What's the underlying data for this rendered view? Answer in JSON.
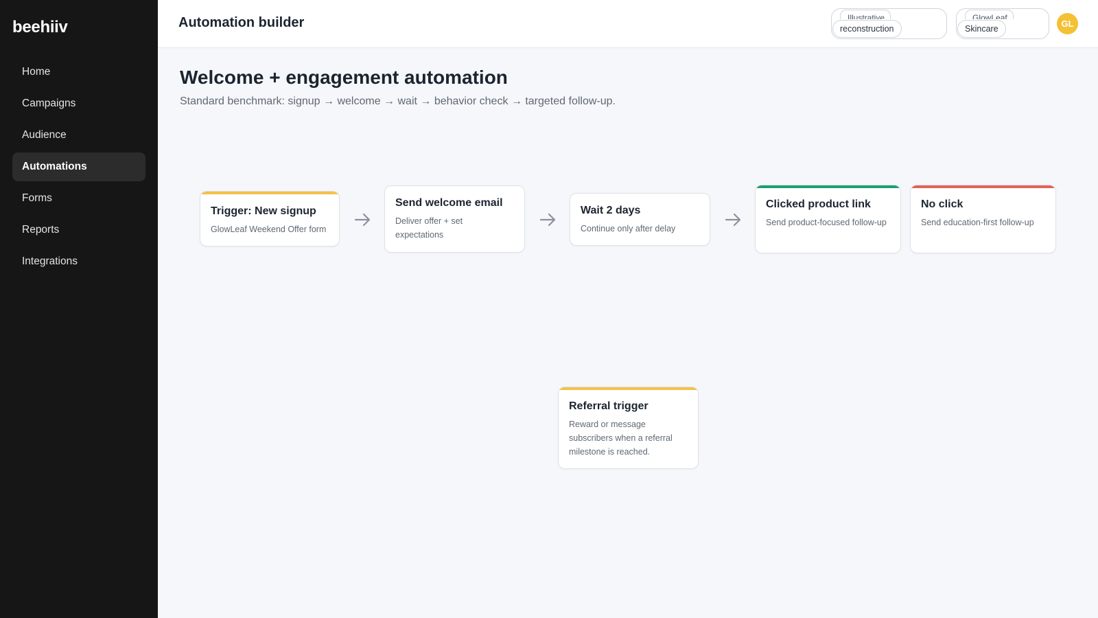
{
  "sidebar": {
    "logo": "beehiiv",
    "items": [
      {
        "label": "Home",
        "active": false
      },
      {
        "label": "Campaigns",
        "active": false
      },
      {
        "label": "Audience",
        "active": false
      },
      {
        "label": "Automations",
        "active": true
      },
      {
        "label": "Forms",
        "active": false
      },
      {
        "label": "Reports",
        "active": false
      },
      {
        "label": "Integrations",
        "active": false
      }
    ]
  },
  "topbar": {
    "title": "Automation builder",
    "chips": [
      {
        "top": "Illustrative",
        "pill": "reconstruction"
      },
      {
        "top": "GlowLeaf",
        "pill": "Skincare"
      }
    ],
    "avatar_initials": "GL"
  },
  "page": {
    "title": "Welcome + engagement automation",
    "subtitle": "Standard benchmark: signup → welcome → wait → behavior check → targeted follow-up."
  },
  "flow": {
    "nodes": [
      {
        "title": "Trigger: New signup",
        "desc": "GlowLeaf Weekend Offer form",
        "accent": "#f4c14a"
      },
      {
        "title": "Send welcome email",
        "desc": "Deliver offer + set expectations",
        "accent": ""
      },
      {
        "title": "Wait 2 days",
        "desc": "Continue only after delay",
        "accent": ""
      },
      {
        "title": "Clicked product link",
        "desc": "Send product-focused follow-up",
        "accent": "#1f9c74"
      },
      {
        "title": "No click",
        "desc": "Send education-first follow-up",
        "accent": "#e06456"
      },
      {
        "title": "Referral trigger",
        "desc": "Reward or message subscribers when a referral milestone is reached.",
        "accent": "#f4c14a"
      }
    ]
  },
  "colors": {
    "sidebar_bg": "#161616",
    "avatar": "#f4c135",
    "arrow": "#8a919c"
  }
}
